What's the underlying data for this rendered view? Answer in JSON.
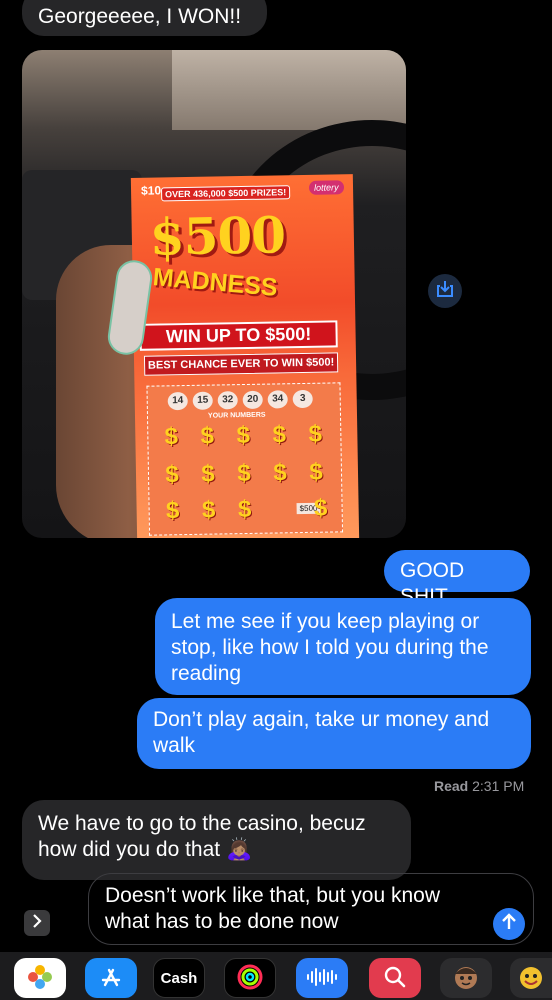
{
  "messages": {
    "top": "Georgeeeee, I WON!!",
    "good": "GOOD SHIT",
    "letme": "Let me see if you keep playing or stop, like how I told you during the reading",
    "dont": "Don’t play again, take ur money and walk",
    "casino": "We have to go to the casino, becuz how did you do that 🙇🏽‍♀️"
  },
  "read_receipt": {
    "label": "Read",
    "time": "2:31 PM"
  },
  "ticket": {
    "price": "$10",
    "prizes": "OVER 436,000 $500 PRIZES!",
    "brand": "lottery",
    "title": "$500",
    "subtitle": "MADNESS",
    "win_up": "WIN UP TO $500!",
    "chance": "BEST CHANCE EVER TO WIN $500!",
    "winning_numbers": [
      "14",
      "15",
      "32",
      "20",
      "34",
      "3"
    ],
    "your_numbers_label": "YOUR NUMBERS",
    "amount": "$500"
  },
  "compose": {
    "text": "Doesn’t work like that, but you know what has to be done now"
  },
  "apps": {
    "cash_label": "Cash"
  },
  "colors": {
    "sent_bubble": "#2b7cf6",
    "received_bubble": "#262628",
    "background": "#000000"
  },
  "icons": [
    "save-to-photos-icon",
    "expand-chevron-icon",
    "send-arrow-icon",
    "photos-app-icon",
    "app-store-icon",
    "cash-app-icon",
    "fitness-icon",
    "audio-message-icon",
    "web-search-icon",
    "memoji-icon"
  ]
}
